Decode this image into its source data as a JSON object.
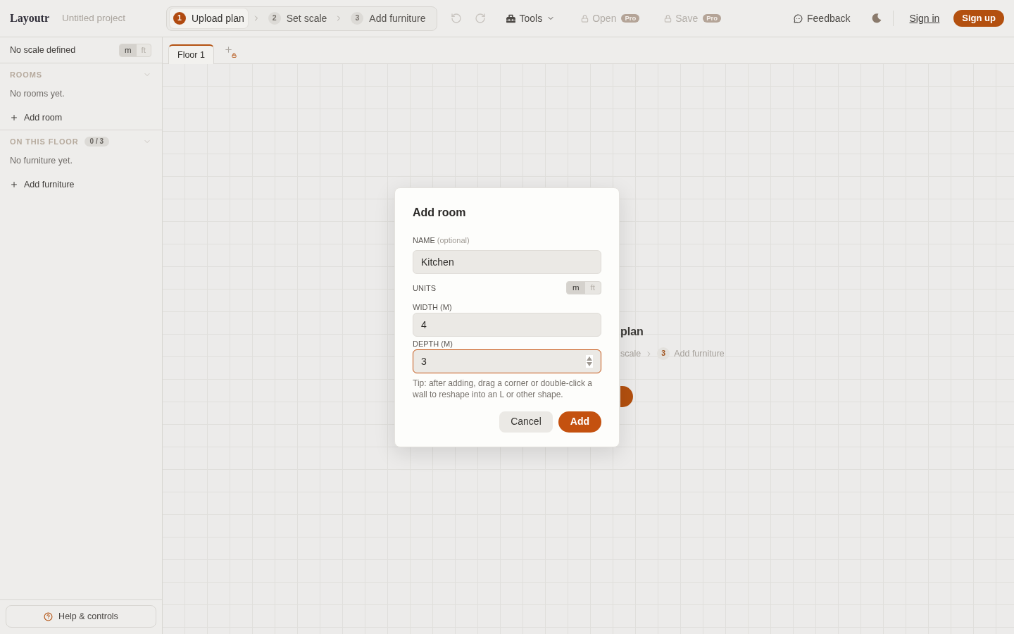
{
  "header": {
    "logo": "Layoutr",
    "project_name": "Untitled project",
    "steps": [
      {
        "number": "1",
        "label": "Upload plan",
        "selected": true
      },
      {
        "number": "2",
        "label": "Set scale",
        "selected": false
      },
      {
        "number": "3",
        "label": "Add furniture",
        "selected": false
      }
    ],
    "history": [
      {
        "kind": "undo",
        "disabled": true
      },
      {
        "kind": "redo",
        "disabled": true
      }
    ],
    "tools": {
      "label": "Tools"
    },
    "pro_actions": [
      {
        "label": "Open",
        "badge": "Pro",
        "locked": true
      },
      {
        "label": "Save",
        "badge": "Pro",
        "locked": true
      }
    ],
    "feedback": "Feedback",
    "sign_in": "Sign in",
    "sign_up": "Sign up"
  },
  "sidebar": {
    "scale_status": "No scale defined",
    "units": [
      {
        "label": "m",
        "selected": true
      },
      {
        "label": "ft",
        "selected": false
      }
    ],
    "sections": [
      {
        "title": "ROOMS",
        "expanded": true,
        "empty_text": "No rooms yet.",
        "add_label": "Add room"
      },
      {
        "title": "ON THIS FLOOR",
        "count": "0 / 3",
        "expanded": true,
        "empty_text": "No furniture yet.",
        "add_label": "Add furniture"
      }
    ],
    "help_button": "Help & controls"
  },
  "floor_tabs": {
    "tabs": [
      {
        "label": "Floor 1",
        "selected": true
      }
    ],
    "add_locked": true
  },
  "canvas": {
    "title": "plan",
    "steps": [
      {
        "label": "scale"
      },
      {
        "number": "3",
        "label": "Add furniture"
      }
    ]
  },
  "dialog": {
    "title": "Add room",
    "fields": [
      {
        "kind": "text",
        "label": "NAME",
        "hint": "(optional)",
        "value": "Kitchen",
        "focused": false
      },
      {
        "kind": "units",
        "label": "UNITS",
        "options": [
          {
            "label": "m",
            "selected": true
          },
          {
            "label": "ft",
            "selected": false
          }
        ]
      },
      {
        "kind": "number",
        "label": "WIDTH (M)",
        "value": "4",
        "focused": false
      },
      {
        "kind": "number",
        "label": "DEPTH (M)",
        "value": "3",
        "focused": true
      }
    ],
    "tip": "Tip: after adding, drag a corner or double-click a wall to reshape into an L or other shape.",
    "buttons": [
      {
        "kind": "secondary",
        "label": "Cancel"
      },
      {
        "kind": "primary",
        "label": "Add"
      }
    ]
  }
}
